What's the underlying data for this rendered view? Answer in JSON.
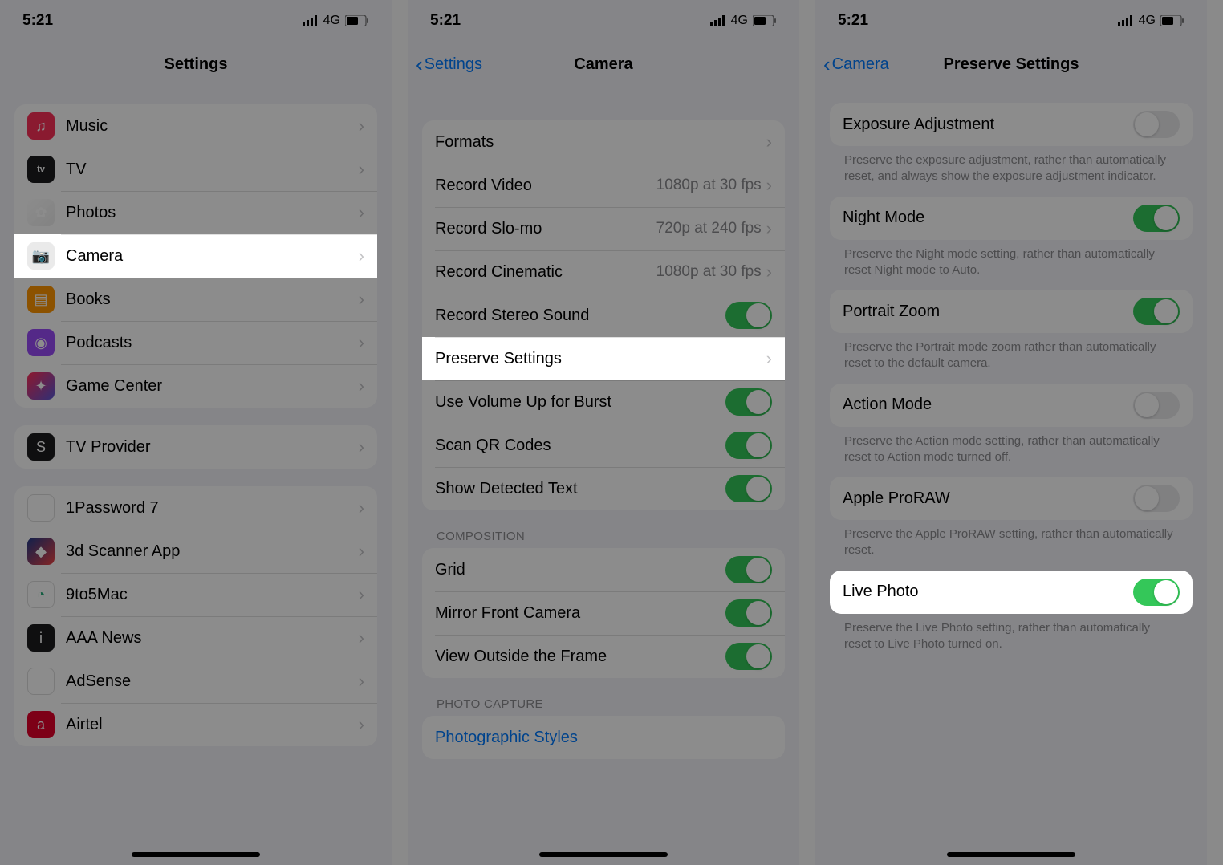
{
  "status": {
    "time": "5:21",
    "network": "4G"
  },
  "screen1": {
    "title": "Settings",
    "groups": [
      {
        "rows": [
          {
            "label": "Music",
            "icon": "music"
          },
          {
            "label": "TV",
            "icon": "tv"
          },
          {
            "label": "Photos",
            "icon": "photos"
          },
          {
            "label": "Camera",
            "icon": "camera",
            "highlight": true
          },
          {
            "label": "Books",
            "icon": "books"
          },
          {
            "label": "Podcasts",
            "icon": "podcasts"
          },
          {
            "label": "Game Center",
            "icon": "gamecenter"
          }
        ]
      },
      {
        "rows": [
          {
            "label": "TV Provider",
            "icon": "tvprovider"
          }
        ]
      },
      {
        "rows": [
          {
            "label": "1Password 7",
            "icon": "1password"
          },
          {
            "label": "3d Scanner App",
            "icon": "3dscanner"
          },
          {
            "label": "9to5Mac",
            "icon": "9to5"
          },
          {
            "label": "AAA News",
            "icon": "aaa"
          },
          {
            "label": "AdSense",
            "icon": "adsense"
          },
          {
            "label": "Airtel",
            "icon": "airtel"
          }
        ]
      }
    ]
  },
  "screen2": {
    "back": "Settings",
    "title": "Camera",
    "rows1": [
      {
        "label": "Formats"
      },
      {
        "label": "Record Video",
        "detail": "1080p at 30 fps"
      },
      {
        "label": "Record Slo-mo",
        "detail": "720p at 240 fps"
      },
      {
        "label": "Record Cinematic",
        "detail": "1080p at 30 fps"
      },
      {
        "label": "Record Stereo Sound",
        "toggle": true,
        "on": true
      },
      {
        "label": "Preserve Settings",
        "highlight": true
      },
      {
        "label": "Use Volume Up for Burst",
        "toggle": true,
        "on": true
      },
      {
        "label": "Scan QR Codes",
        "toggle": true,
        "on": true
      },
      {
        "label": "Show Detected Text",
        "toggle": true,
        "on": true
      }
    ],
    "header2": "Composition",
    "rows2": [
      {
        "label": "Grid",
        "toggle": true,
        "on": true
      },
      {
        "label": "Mirror Front Camera",
        "toggle": true,
        "on": true
      },
      {
        "label": "View Outside the Frame",
        "toggle": true,
        "on": true
      }
    ],
    "header3": "Photo Capture",
    "link3": "Photographic Styles"
  },
  "screen3": {
    "back": "Camera",
    "title": "Preserve Settings",
    "items": [
      {
        "label": "Exposure Adjustment",
        "on": false,
        "footer": "Preserve the exposure adjustment, rather than automatically reset, and always show the exposure adjustment indicator."
      },
      {
        "label": "Night Mode",
        "on": true,
        "footer": "Preserve the Night mode setting, rather than automatically reset Night mode to Auto."
      },
      {
        "label": "Portrait Zoom",
        "on": true,
        "footer": "Preserve the Portrait mode zoom rather than automatically reset to the default camera."
      },
      {
        "label": "Action Mode",
        "on": false,
        "footer": "Preserve the Action mode setting, rather than automatically reset to Action mode turned off."
      },
      {
        "label": "Apple ProRAW",
        "on": false,
        "footer": "Preserve the Apple ProRAW setting, rather than automatically reset."
      },
      {
        "label": "Live Photo",
        "on": true,
        "highlight": true,
        "footer": "Preserve the Live Photo setting, rather than automatically reset to Live Photo turned on."
      }
    ]
  }
}
